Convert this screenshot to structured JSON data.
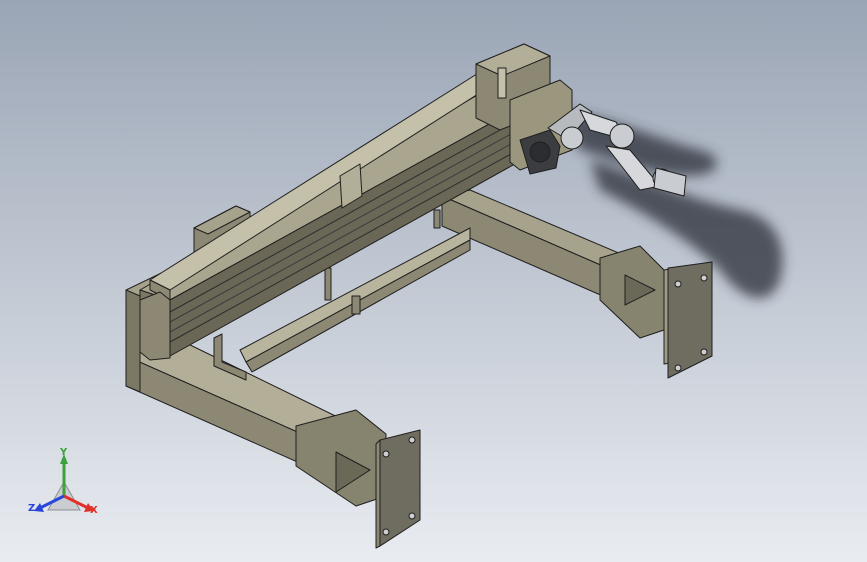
{
  "viewport": {
    "background_top": "#9aa5b5",
    "background_bottom": "#e9ecf1",
    "model_body_color": "#8c8873",
    "model_edge_color": "#1f1f1f",
    "plate_color": "#6f6c60",
    "arm_color": "#c9ccd0",
    "shadow_color": "#2a2f38"
  },
  "triad": {
    "x_label": "X",
    "y_label": "Y",
    "z_label": "Z",
    "x_color": "#e0302a",
    "y_color": "#3aa23a",
    "z_color": "#2a46d8"
  }
}
